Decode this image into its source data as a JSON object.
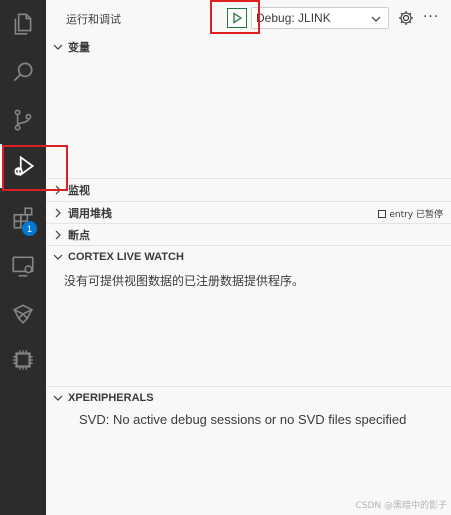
{
  "sidebar": {
    "run_title": "运行和调试",
    "config_label": "Debug: JLINK",
    "more_label": "···"
  },
  "sections": {
    "variables": "变量",
    "watch": "监视",
    "callstack": "调用堆栈",
    "callstack_status": "entry 已暂停",
    "breakpoints": "断点",
    "cortex_live_watch": "CORTEX LIVE WATCH",
    "cortex_live_watch_message": "没有可提供视图数据的已注册数据提供程序。",
    "xperipherals": "XPERIPHERALS",
    "xperipherals_message": "SVD: No active debug sessions or no SVD files specified"
  },
  "activity_bar": {
    "items": [
      "explorer-icon",
      "search-icon",
      "source-control-icon",
      "run-debug-icon",
      "extensions-icon",
      "remote-explorer-icon",
      "keil-icon",
      "chip-icon"
    ],
    "extensions_badge": "1"
  },
  "watermark": "CSDN @黑暗中的影子",
  "colors": {
    "activity_bar_bg": "#2c2c2c",
    "sidebar_bg": "#f8f8f8",
    "highlight_red": "#e02020",
    "badge_blue": "#0078d4",
    "play_green": "#1f7a3f"
  }
}
